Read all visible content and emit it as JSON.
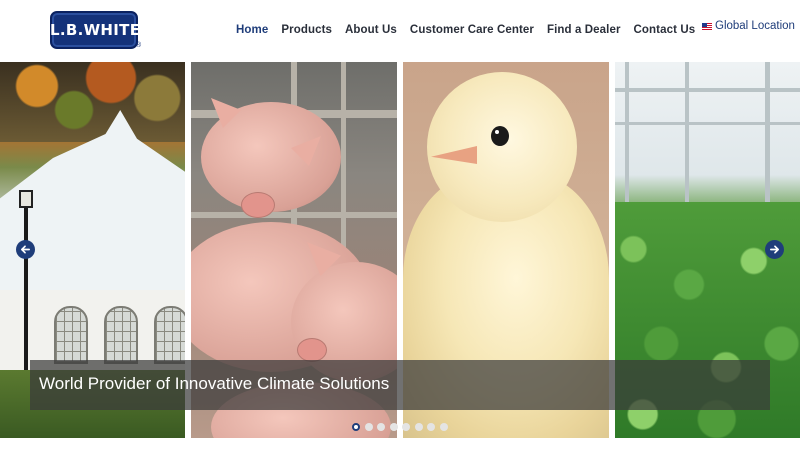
{
  "logo": {
    "text": "L.B.WHITE",
    "registered": "®"
  },
  "nav": {
    "items": [
      "Home",
      "Products",
      "About Us",
      "Customer Care Center",
      "Find a Dealer",
      "Contact Us"
    ],
    "active": "Home"
  },
  "global_location": {
    "label": "Global Location",
    "icon": "us-flag-icon"
  },
  "slider": {
    "caption": "World Provider of Innovative Climate Solutions",
    "slide_count": 8,
    "active_slide": 1,
    "prev_icon": "arrow-left-icon",
    "next_icon": "arrow-right-icon"
  },
  "colors": {
    "brand": "#1f3d7a",
    "caption_bg": "#3a3a3a",
    "text": "#2a2f3a"
  }
}
